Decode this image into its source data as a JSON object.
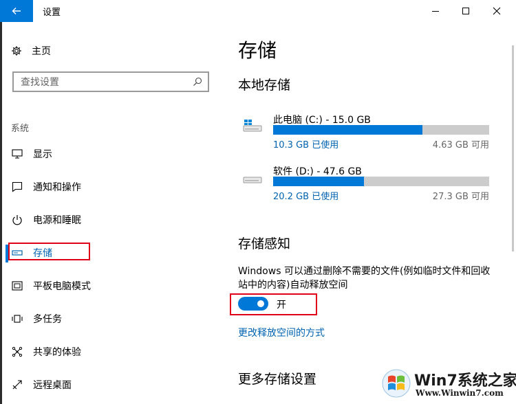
{
  "window": {
    "title": "设置"
  },
  "nav": {
    "home": "主页",
    "search_placeholder": "查找设置",
    "section": "系统",
    "items": [
      {
        "label": "显示",
        "icon": "display-icon"
      },
      {
        "label": "通知和操作",
        "icon": "notification-icon"
      },
      {
        "label": "电源和睡眠",
        "icon": "power-icon"
      },
      {
        "label": "存储",
        "icon": "storage-icon",
        "active": true
      },
      {
        "label": "平板电脑模式",
        "icon": "tablet-icon"
      },
      {
        "label": "多任务",
        "icon": "multitask-icon"
      },
      {
        "label": "共享的体验",
        "icon": "share-icon"
      },
      {
        "label": "远程桌面",
        "icon": "remote-desktop-icon"
      }
    ]
  },
  "main": {
    "title": "存储",
    "local_storage_heading": "本地存储",
    "drives": [
      {
        "name": "此电脑 (C:) - 15.0 GB",
        "used": "10.3 GB 已使用",
        "free": "4.63 GB 可用",
        "used_fraction": 0.69
      },
      {
        "name": "软件 (D:) - 47.6 GB",
        "used": "20.2 GB 已使用",
        "free": "27.3 GB 可用",
        "used_fraction": 0.42
      }
    ],
    "storage_sense_heading": "存储感知",
    "storage_sense_description": "Windows 可以通过删除不需要的文件(例如临时文件和回收站中的内容)自动释放空间",
    "toggle_state": "开",
    "change_link": "更改释放空间的方式",
    "more_heading": "更多存储设置"
  },
  "watermark": {
    "title": "Win7系统之家",
    "url": "Www.Winwin7.com"
  },
  "colors": {
    "accent": "#0078d7",
    "link": "#0063b1",
    "highlight_box": "#e1001a"
  }
}
